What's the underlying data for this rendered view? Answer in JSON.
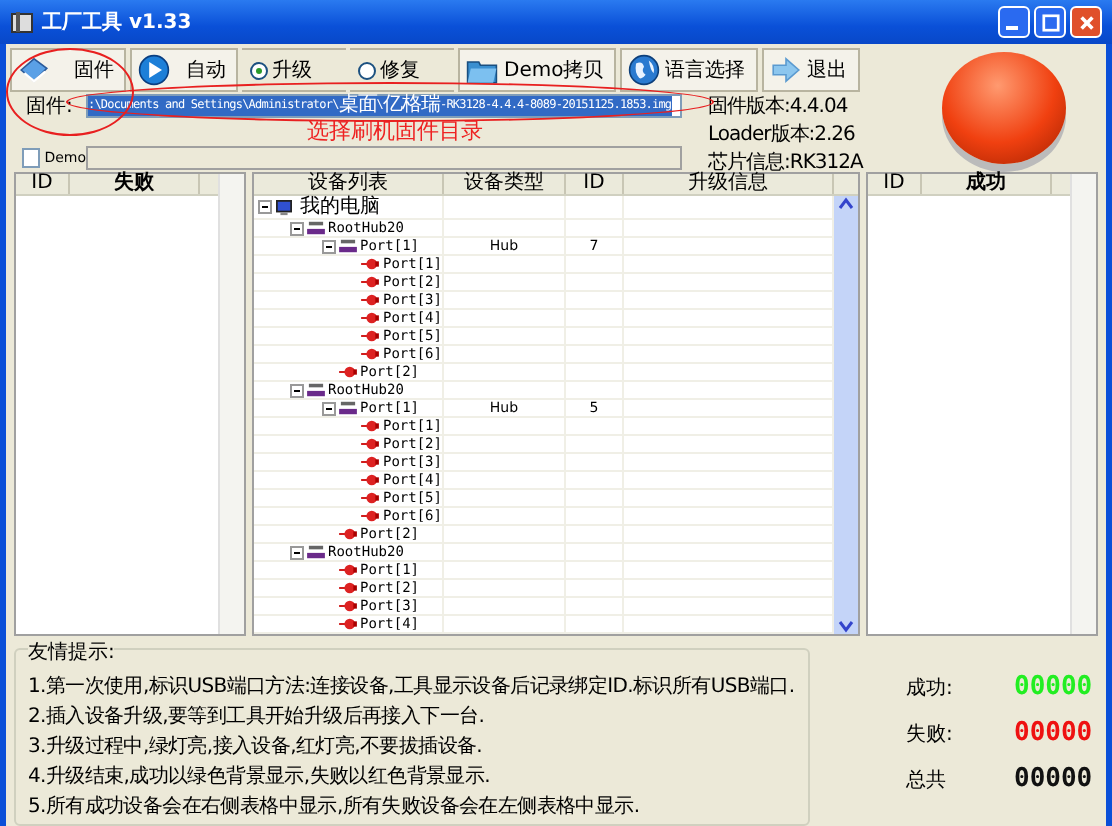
{
  "window": {
    "title": "工厂工具 v1.33"
  },
  "toolbar": [
    {
      "kind": "button",
      "label": "固件"
    },
    {
      "kind": "button",
      "label": "自动"
    },
    {
      "kind": "radio",
      "label": "升级",
      "selected": true
    },
    {
      "kind": "radio",
      "label": "修复",
      "selected": false
    },
    {
      "kind": "button",
      "label": "Demo拷贝"
    },
    {
      "kind": "button",
      "label": "语言选择"
    },
    {
      "kind": "button",
      "label": "退出"
    }
  ],
  "firmware": {
    "label": "固件:",
    "path": ":\\Documents and Settings\\Administrator\\桌面\\亿格瑞-RK3128-4.4.4-8089-20151125.1853.img"
  },
  "annotation": "选择刷机固件目录",
  "demo": {
    "label": "Demo",
    "checked": false
  },
  "info": [
    "固件版本:4.4.04",
    "Loader版本:2.26",
    "芯片信息:RK312A"
  ],
  "failed_table": {
    "columns": [
      "ID",
      "失败"
    ]
  },
  "device_table": {
    "columns": [
      "设备列表",
      "设备类型",
      "ID",
      "升级信息"
    ],
    "tree": [
      {
        "kind": "computer",
        "name": "我的电脑",
        "expanded": true,
        "children": [
          {
            "kind": "hub",
            "name": "RootHub20",
            "expanded": true,
            "children": [
              {
                "kind": "hub",
                "name": "Port[1]",
                "type": "Hub",
                "id": "7",
                "expanded": true,
                "children": [
                  {
                    "kind": "port",
                    "name": "Port[1]"
                  },
                  {
                    "kind": "port",
                    "name": "Port[2]"
                  },
                  {
                    "kind": "port",
                    "name": "Port[3]"
                  },
                  {
                    "kind": "port",
                    "name": "Port[4]"
                  },
                  {
                    "kind": "port",
                    "name": "Port[5]"
                  },
                  {
                    "kind": "port",
                    "name": "Port[6]"
                  }
                ]
              },
              {
                "kind": "port",
                "name": "Port[2]"
              }
            ]
          },
          {
            "kind": "hub",
            "name": "RootHub20",
            "expanded": true,
            "children": [
              {
                "kind": "hub",
                "name": "Port[1]",
                "type": "Hub",
                "id": "5",
                "expanded": true,
                "children": [
                  {
                    "kind": "port",
                    "name": "Port[1]"
                  },
                  {
                    "kind": "port",
                    "name": "Port[2]"
                  },
                  {
                    "kind": "port",
                    "name": "Port[3]"
                  },
                  {
                    "kind": "port",
                    "name": "Port[4]"
                  },
                  {
                    "kind": "port",
                    "name": "Port[5]"
                  },
                  {
                    "kind": "port",
                    "name": "Port[6]"
                  }
                ]
              },
              {
                "kind": "port",
                "name": "Port[2]"
              }
            ]
          },
          {
            "kind": "hub",
            "name": "RootHub20",
            "expanded": true,
            "children": [
              {
                "kind": "port",
                "name": "Port[1]"
              },
              {
                "kind": "port",
                "name": "Port[2]"
              },
              {
                "kind": "port",
                "name": "Port[3]"
              },
              {
                "kind": "port",
                "name": "Port[4]"
              }
            ]
          }
        ]
      }
    ]
  },
  "success_table": {
    "columns": [
      "ID",
      "成功"
    ]
  },
  "tips": {
    "title": "友情提示:",
    "items": [
      "1.第一次使用,标识USB端口方法:连接设备,工具显示设备后记录绑定ID.标识所有USB端口.",
      "2.插入设备升级,要等到工具开始升级后再接入下一台.",
      "3.升级过程中,绿灯亮,接入设备,红灯亮,不要拔插设备.",
      "4.升级结束,成功以绿色背景显示,失败以红色背景显示.",
      "5.所有成功设备会在右侧表格中显示,所有失败设备会在左侧表格中显示."
    ]
  },
  "counters": [
    {
      "label": "成功:",
      "value": "00000",
      "color": "#22ee22"
    },
    {
      "label": "失败:",
      "value": "00000",
      "color": "#ee1111"
    },
    {
      "label": "总共",
      "value": "00000",
      "color": "#111111"
    }
  ]
}
